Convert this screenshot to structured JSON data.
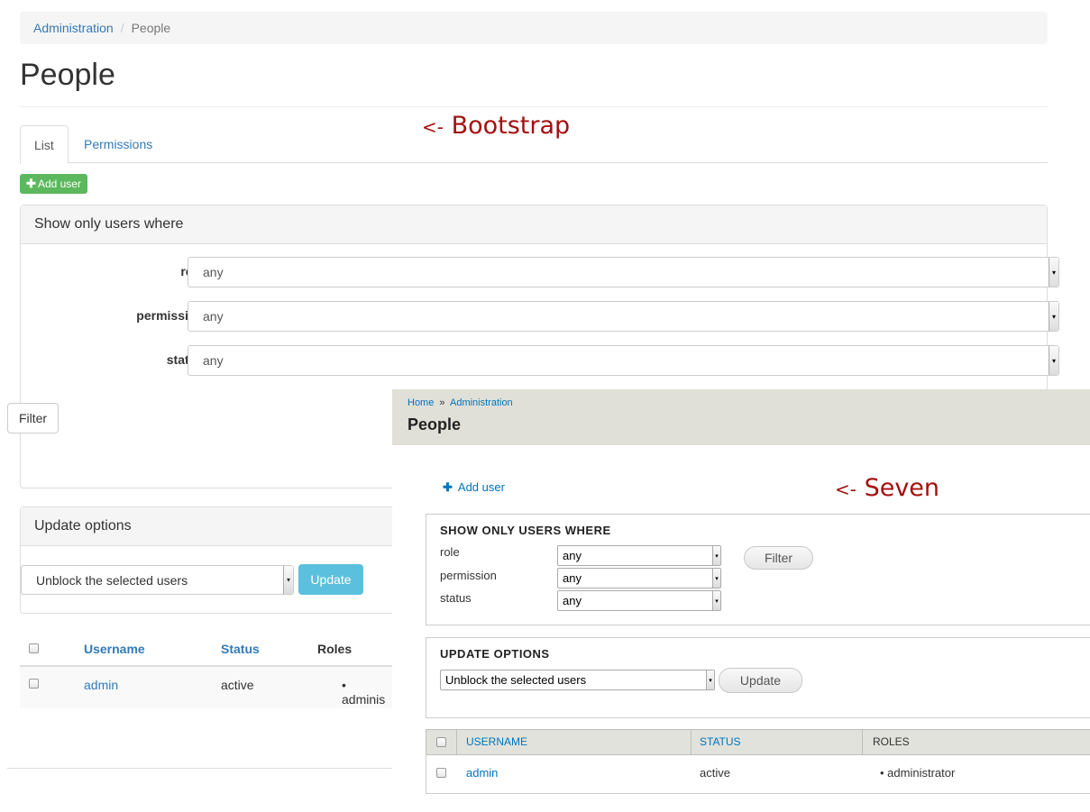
{
  "bootstrap": {
    "breadcrumb": {
      "root": "Administration",
      "separator": "/",
      "current": "People"
    },
    "title": "People",
    "tabs": [
      {
        "label": "List"
      },
      {
        "label": "Permissions"
      }
    ],
    "add_user_label": "Add user",
    "filter": {
      "heading": "Show only users where",
      "fields": [
        {
          "label": "role",
          "value": "any"
        },
        {
          "label": "permission",
          "value": "any"
        },
        {
          "label": "status",
          "value": "any"
        }
      ],
      "button": "Filter"
    },
    "update": {
      "heading": "Update options",
      "select_value": "Unblock the selected users",
      "button": "Update"
    },
    "table": {
      "headers": {
        "username": "Username",
        "status": "Status",
        "roles": "Roles"
      },
      "rows": [
        {
          "username": "admin",
          "status": "active",
          "roles": "• adminis"
        }
      ]
    },
    "accent": "#337ab7",
    "success_color": "#5cb85c",
    "info_color": "#5bc0de"
  },
  "annotations": {
    "bootstrap": {
      "arrow": "<-",
      "text": "Bootstrap"
    },
    "seven": {
      "arrow": "<-",
      "text": "Seven"
    }
  },
  "seven": {
    "breadcrumb": {
      "home": "Home",
      "separator": "»",
      "admin": "Administration"
    },
    "title": "People",
    "add_user_label": "Add user",
    "filter": {
      "legend": "SHOW ONLY USERS WHERE",
      "fields": [
        {
          "label": "role",
          "value": "any"
        },
        {
          "label": "permission",
          "value": "any"
        },
        {
          "label": "status",
          "value": "any"
        }
      ],
      "button": "Filter"
    },
    "update": {
      "legend": "UPDATE OPTIONS",
      "select_value": "Unblock the selected users",
      "button": "Update"
    },
    "table": {
      "headers": {
        "username": "USERNAME",
        "status": "STATUS",
        "roles": "ROLES"
      },
      "rows": [
        {
          "username": "admin",
          "status": "active",
          "roles": "• administrator"
        }
      ]
    },
    "accent": "#0074bd",
    "annotation_color": "#a50f0f"
  }
}
